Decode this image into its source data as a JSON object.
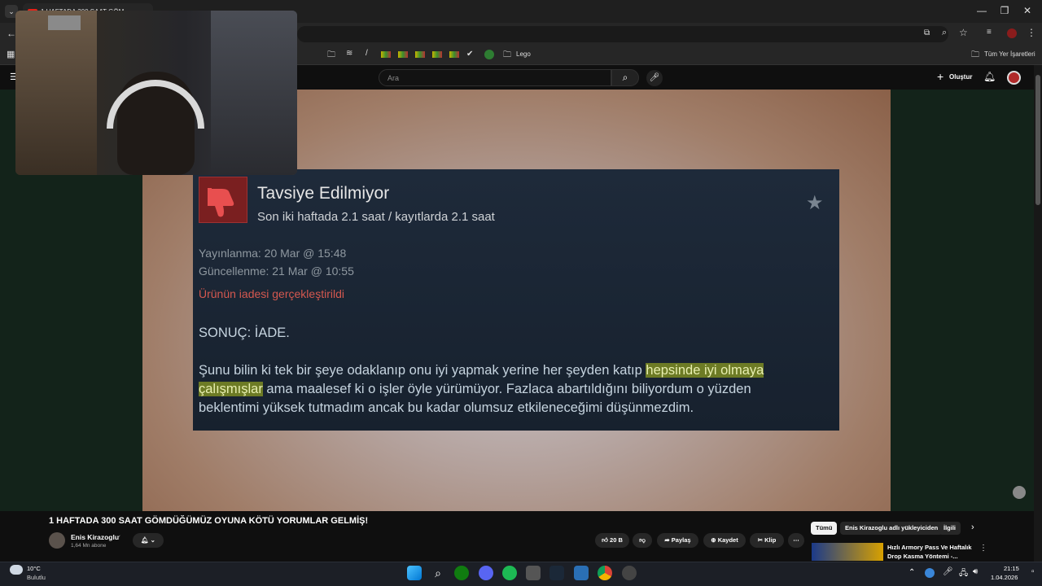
{
  "browser": {
    "tab_title": "1 HAFTADA 300 SAAT GÖM...",
    "bookmark_folder_1": "Lego",
    "bookmark_folder_2": "Tüm Yer İşaretleri"
  },
  "youtube": {
    "search_placeholder": "Ara",
    "create_label": "Oluştur"
  },
  "review": {
    "title": "Tavsiye Edilmiyor",
    "playtime": "Son iki haftada 2.1 saat / kayıtlarda 2.1 saat",
    "posted": "Yayınlanma: 20 Mar @ 15:48",
    "updated": "Güncellenme: 21 Mar @ 10:55",
    "refund": "Ürünün iadesi gerçekleştirildi",
    "verdict": "SONUÇ: İADE.",
    "body_1": "Şunu bilin ki tek bir şeye odaklanıp onu iyi yapmak yerine her şeyden katıp ",
    "body_hl_1": "hepsinde iyi olmaya",
    "body_hl_2": "çalışmışlar",
    "body_2": " ama maalesef ki o işler öyle yürümüyor. Fazlaca abartıldığını biliyordum o yüzden",
    "body_3": "beklentimi yüksek tutmadım ancak bu kadar olumsuz etkileneceğimi düşünmezdim."
  },
  "video": {
    "title": "1 HAFTADA 300 SAAT GÖMDÜĞÜMÜZ OYUNA KÖTÜ YORUMLAR GELMİŞ!",
    "channel": "Enis Kirazoglu",
    "subscribers": "1,64 Mn abone",
    "likes": "20 B",
    "share": "Paylaş",
    "save": "Kaydet",
    "clip": "Klip"
  },
  "sidebar": {
    "chip_all": "Tümü",
    "chip_uploader": "Enis Kirazoglu adlı yükleyiciden",
    "chip_related": "İlgili",
    "rec_title_1": "Hızlı Armory Pass Ve Haftalık",
    "rec_title_2": "Drop Kasma Yöntemi -..."
  },
  "taskbar": {
    "temp": "10°C",
    "weather": "Bulutlu",
    "time": "21:15",
    "date": "1.04.2026"
  },
  "colors": {
    "review_bg": "#1b2838",
    "refund_red": "#d4584f",
    "highlight": "#6d7b25",
    "thumb_red": "#7a1f20"
  }
}
